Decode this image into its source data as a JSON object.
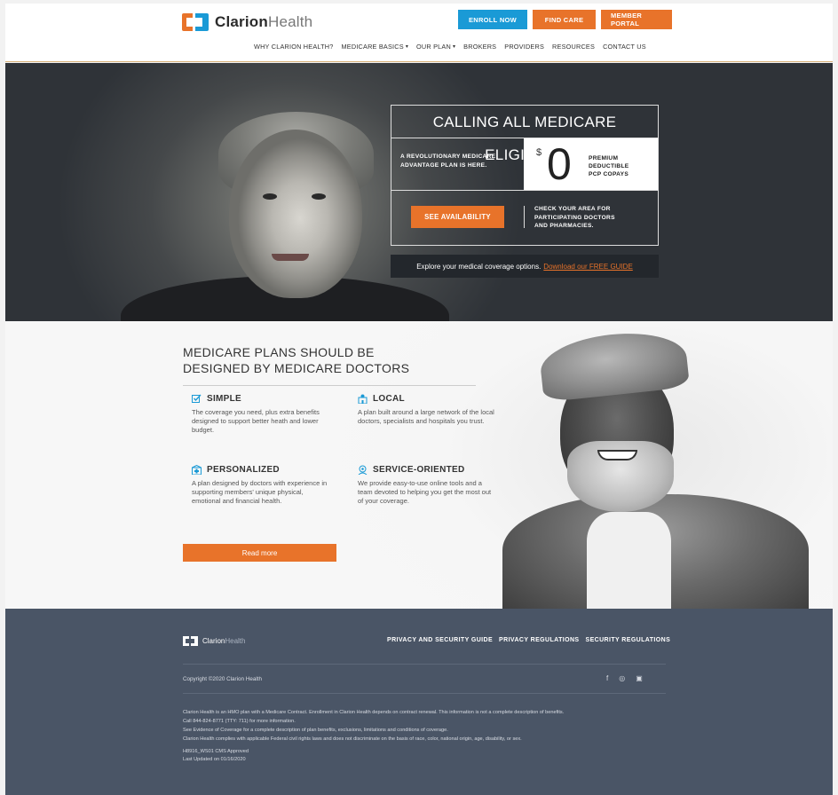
{
  "brand": {
    "name_bold": "Clarion",
    "name_light": "Health",
    "color_orange": "#e8732a",
    "color_blue": "#1a9ad6"
  },
  "header": {
    "buttons": {
      "enroll": "ENROLL NOW",
      "find_care": "FIND CARE",
      "member_portal": "MEMBER PORTAL"
    },
    "nav": [
      {
        "label": "WHY CLARION HEALTH?"
      },
      {
        "label": "MEDICARE BASICS",
        "dropdown": true
      },
      {
        "label": "OUR PLAN",
        "dropdown": true
      },
      {
        "label": "BROKERS"
      },
      {
        "label": "PROVIDERS"
      },
      {
        "label": "RESOURCES"
      },
      {
        "label": "CONTACT US"
      }
    ]
  },
  "hero": {
    "title": "CALLING ALL MEDICARE ELIGIBLES",
    "plan_line1": "A REVOLUTIONARY MEDICARE",
    "plan_line2": "ADVANTAGE PLAN IS HERE.",
    "dollar": "$",
    "zero": "0",
    "zero_items": [
      "PREMIUM",
      "DEDUCTIBLE",
      "PCP COPAYS"
    ],
    "availability_button": "SEE AVAILABILITY",
    "check_line1": "CHECK YOUR AREA FOR",
    "check_line2": "PARTICIPATING DOCTORS",
    "check_line3": "AND PHARMACIES.",
    "guide_text": "Explore your medical coverage options.",
    "guide_link": "Download our FREE GUIDE"
  },
  "features_section": {
    "title_line1": "MEDICARE PLANS SHOULD BE",
    "title_line2": "DESIGNED BY MEDICARE DOCTORS",
    "features": [
      {
        "title": "SIMPLE",
        "icon": "checkbox-icon",
        "body": "The coverage you need, plus extra benefits designed to support better heath and lower budget."
      },
      {
        "title": "LOCAL",
        "icon": "location-building-icon",
        "body": "A plan built around a large network of the local doctors, specialists and hospitals you trust."
      },
      {
        "title": "PERSONALIZED",
        "icon": "clinic-icon",
        "body": "A plan designed by doctors with experience in supporting members' unique physical, emotional and financial health."
      },
      {
        "title": "SERVICE-ORIENTED",
        "icon": "support-agent-icon",
        "body": "We provide easy-to-use online tools and a team devoted to helping you get the most out of your coverage."
      }
    ],
    "read_more": "Read more"
  },
  "footer": {
    "links": [
      "PRIVACY AND SECURITY GUIDE",
      "PRIVACY REGULATIONS",
      "SECURITY REGULATIONS"
    ],
    "copyright": "Copyright ©2020 Clarion Health",
    "social": [
      {
        "icon": "facebook-icon",
        "glyph": "f"
      },
      {
        "icon": "instagram-icon",
        "glyph": "◎"
      },
      {
        "icon": "linkedin-icon",
        "glyph": "▣"
      }
    ],
    "legal": [
      "Clarion Health is an HMO plan with a Medicare Contract. Enrollment in Clarion Health depends on contract renewal. This information is not a complete description of benefits.",
      "Call 844-824-8771 (TTY: 711) for more information.",
      "See Evidence of Coverage for a complete description of plan benefits, exclusions, limitations and conditions of coverage.",
      "Clarion Health complies with applicable Federal civil rights laws and does not discriminate on the basis of race, color, national origin, age, disability, or sex."
    ],
    "approval": "H8916_WS01 CMS Approved",
    "updated": "Last Updated on 01/16/2020"
  }
}
